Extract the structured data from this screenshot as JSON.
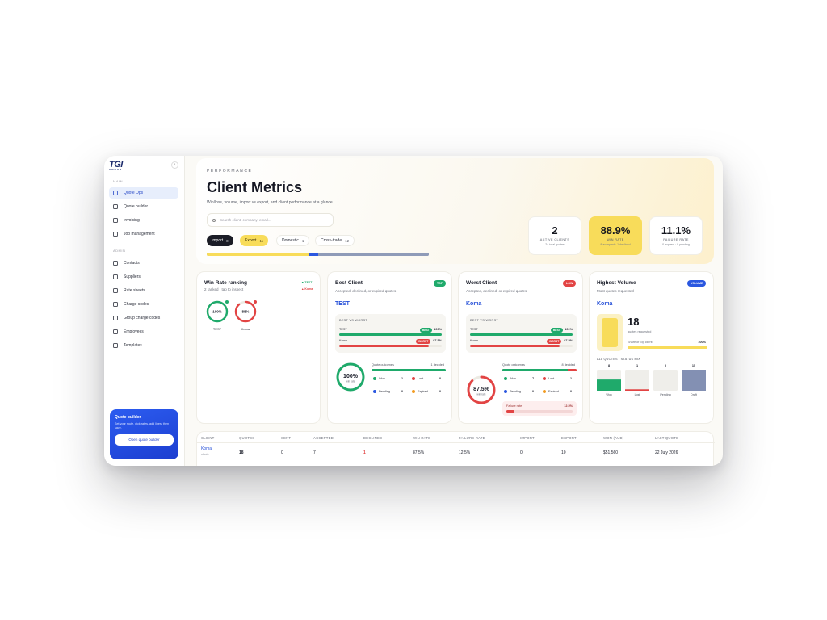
{
  "brand": {
    "name": "TGI",
    "sub": "GROUP"
  },
  "sidebar": {
    "main_label": "MAIN",
    "admin_label": "ADMIN",
    "main_items": [
      {
        "label": "Quote Ops"
      },
      {
        "label": "Quote builder"
      },
      {
        "label": "Invoicing"
      },
      {
        "label": "Job management"
      }
    ],
    "admin_items": [
      {
        "label": "Contacts"
      },
      {
        "label": "Suppliers"
      },
      {
        "label": "Rate sheets"
      },
      {
        "label": "Charge codes"
      },
      {
        "label": "Group charge codes"
      },
      {
        "label": "Employees"
      },
      {
        "label": "Templates"
      }
    ],
    "promo": {
      "title": "Quote builder",
      "desc": "Set your route, pick rates, add lines, then save.",
      "button": "Open quote builder"
    }
  },
  "header": {
    "eyebrow": "PERFORMANCE",
    "title": "Client Metrics",
    "subtitle": "Win/loss, volume, import vs export, and client performance at a glance",
    "search_placeholder": "Search client, company, email...",
    "filters": [
      {
        "label": "Import",
        "count": "0"
      },
      {
        "label": "Export",
        "count": "11"
      },
      {
        "label": "Domestic",
        "count": "1"
      },
      {
        "label": "Cross-trade",
        "count": "12"
      }
    ],
    "mix_bar": {
      "yellow": 0.46,
      "blue": 0.04,
      "slate": 0.5
    }
  },
  "kpis": [
    {
      "value": "2",
      "label": "ACTIVE CLIENTS",
      "sub": "24 total quotes"
    },
    {
      "value": "88.9%",
      "label": "WIN RATE",
      "sub": "8 accepted · 1 declined"
    },
    {
      "value": "11.1%",
      "label": "FAILURE RATE",
      "sub": "0 expired · 0 pending"
    }
  ],
  "ranking": {
    "title": "Win Rate ranking",
    "sub": "2 ranked · tap to inspect",
    "badge_top": "▼ TEST",
    "badge_bottom": "▲ Koma",
    "items": [
      {
        "pct_label": "100%",
        "name": "TEST",
        "value": 1.0,
        "color": "#1faa6b"
      },
      {
        "pct_label": "88%",
        "name": "Koma",
        "value": 0.88,
        "color": "#e24444"
      }
    ]
  },
  "best": {
    "title": "Best Client",
    "tag": "TOP",
    "sub": "Accepted, declined, or expired quotes",
    "client": "TEST",
    "bvw_title": "BEST VS WORST",
    "rows": [
      {
        "name": "TEST",
        "badge": "BEST",
        "value": "100%",
        "fill": 1.0
      },
      {
        "name": "Koma",
        "badge": "WORST",
        "value": "87.5%",
        "fill": 0.875
      }
    ],
    "ring_value": "100%",
    "ring_sub": "win rate",
    "ring_fill": 1.0,
    "outcomes_title": "Quote outcomes",
    "outcomes_right": "1 decided",
    "outcome_fill": 1.0,
    "outcomes": [
      {
        "label": "Won",
        "value": "1"
      },
      {
        "label": "Lost",
        "value": "0"
      },
      {
        "label": "Pending",
        "value": "0"
      },
      {
        "label": "Expired",
        "value": "0"
      }
    ]
  },
  "worst": {
    "title": "Worst Client",
    "tag": "LOW",
    "sub": "Accepted, declined, or expired quotes",
    "client": "Koma",
    "bvw_title": "BEST VS WORST",
    "rows": [
      {
        "name": "TEST",
        "badge": "BEST",
        "value": "100%",
        "fill": 1.0
      },
      {
        "name": "Koma",
        "badge": "WORST",
        "value": "87.5%",
        "fill": 0.875
      }
    ],
    "ring_value": "87.5%",
    "ring_sub": "win rate",
    "ring_fill": 0.875,
    "outcomes_title": "Quote outcomes",
    "outcomes_right": "8 decided",
    "outcome_fill": 0.875,
    "outcomes": [
      {
        "label": "Won",
        "value": "7"
      },
      {
        "label": "Lost",
        "value": "1"
      },
      {
        "label": "Pending",
        "value": "0"
      },
      {
        "label": "Expired",
        "value": "0"
      }
    ],
    "failure_label": "Failure rate",
    "failure_value": "12.5%",
    "failure_fill": 0.125
  },
  "volume": {
    "title": "Highest Volume",
    "tag": "VOLUME",
    "sub": "Most quotes requested",
    "client": "Koma",
    "count": "18",
    "count_sub": "quotes requested",
    "share_label": "Share of top client",
    "share_value": "100%",
    "share_fill": 1.0,
    "status_title": "ALL QUOTES · STATUS MIX",
    "status": [
      {
        "label": "Won",
        "count": "8",
        "value": 8,
        "color": "#1faa6b"
      },
      {
        "label": "Lost",
        "count": "1",
        "value": 1,
        "color": "#e24444"
      },
      {
        "label": "Pending",
        "count": "0",
        "value": 0,
        "color": "#cfd3dc"
      },
      {
        "label": "Draft",
        "count": "15",
        "value": 15,
        "color": "#8390b3"
      }
    ]
  },
  "table": {
    "headers": [
      "CLIENT",
      "QUOTES",
      "SENT",
      "ACCEPTED",
      "DECLINED",
      "WIN RATE",
      "FAILURE RATE",
      "IMPORT",
      "EXPORT",
      "WON (AUD)",
      "LAST QUOTE"
    ],
    "row": {
      "client": "Koma",
      "client_sub": "ubnic",
      "cells": [
        "18",
        "0",
        "7",
        "1",
        "87.5%",
        "12.5%",
        "0",
        "10",
        "$51,560",
        "22 July 2026"
      ]
    }
  },
  "colors": {
    "accent_blue": "#2a57e0",
    "green": "#1faa6b",
    "red": "#e24444",
    "yellow": "#f8dc5a",
    "dark": "#15171f"
  }
}
